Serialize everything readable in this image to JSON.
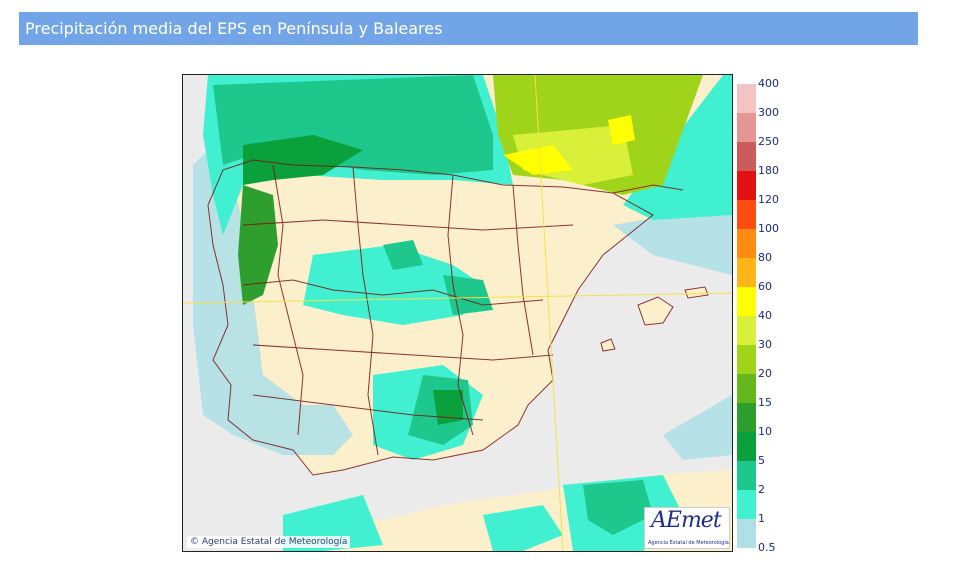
{
  "header": {
    "title": "Precipitación media del EPS en Península y Baleares"
  },
  "map": {
    "copyright": "© Agencia Estatal de Meteorología",
    "logo": {
      "word": "AEmet",
      "subtitle": "Agencia Estatal de Meteorología"
    },
    "colors": {
      "land": "#fbefcc",
      "sea": "#ebebeb",
      "border": "#7a1414",
      "gridline": "#f2e24a"
    }
  },
  "legend": {
    "labels": [
      "400",
      "300",
      "250",
      "180",
      "120",
      "100",
      "80",
      "60",
      "40",
      "30",
      "20",
      "15",
      "10",
      "5",
      "2",
      "1",
      "0.5"
    ],
    "colors": [
      "#f2c4c4",
      "#e49595",
      "#cc5c5c",
      "#e31212",
      "#ff4d12",
      "#ff8c12",
      "#ffb41a",
      "#ffff00",
      "#d9f03a",
      "#a0d41a",
      "#64b81e",
      "#2e9e2e",
      "#0aa03c",
      "#1ec88c",
      "#40f0d0",
      "#b0e0e6"
    ]
  }
}
